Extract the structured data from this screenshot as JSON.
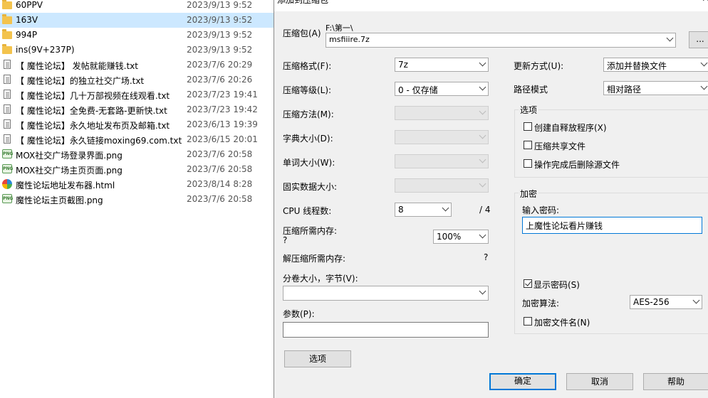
{
  "files": [
    {
      "name": "60PPV",
      "date": "2023/9/13 9:52",
      "type": "folder",
      "selected": false
    },
    {
      "name": "163V",
      "date": "2023/9/13 9:52",
      "type": "folder",
      "selected": true
    },
    {
      "name": "994P",
      "date": "2023/9/13 9:52",
      "type": "folder",
      "selected": false
    },
    {
      "name": "ins(9V+237P)",
      "date": "2023/9/13 9:52",
      "type": "folder",
      "selected": false
    },
    {
      "name": "【 魔性论坛】 发帖就能赚钱.txt",
      "date": "2023/7/6 20:29",
      "type": "txt",
      "selected": false
    },
    {
      "name": "【 魔性论坛】的独立社交广场.txt",
      "date": "2023/7/6 20:26",
      "type": "txt",
      "selected": false
    },
    {
      "name": "【 魔性论坛】几十万部视频在线观看.txt",
      "date": "2023/7/23 19:41",
      "type": "txt",
      "selected": false
    },
    {
      "name": "【 魔性论坛】全免费-无套路-更新快.txt",
      "date": "2023/7/23 19:42",
      "type": "txt",
      "selected": false
    },
    {
      "name": "【 魔性论坛】永久地址发布页及邮箱.txt",
      "date": "2023/6/13 19:39",
      "type": "txt",
      "selected": false
    },
    {
      "name": "【 魔性论坛】永久链接moxing69.com.txt",
      "date": "2023/6/15 20:01",
      "type": "txt",
      "selected": false
    },
    {
      "name": "MOX社交广场登录界面.png",
      "date": "2023/7/6 20:58",
      "type": "png",
      "selected": false
    },
    {
      "name": "MOX社交广场主页页面.png",
      "date": "2023/7/6 20:58",
      "type": "png",
      "selected": false
    },
    {
      "name": "魔性论坛地址发布器.html",
      "date": "2023/8/14 8:28",
      "type": "html",
      "selected": false
    },
    {
      "name": "魔性论坛主页截图.png",
      "date": "2023/7/6 20:58",
      "type": "png",
      "selected": false
    }
  ],
  "dialog": {
    "title": "添加到压缩包",
    "close": "✕",
    "archive_label": "压缩包(A)",
    "archive_path": "F:\\第一\\",
    "archive_name": "msfiiire.7z",
    "browse": "...",
    "format_label": "压缩格式(F):",
    "format_value": "7z",
    "level_label": "压缩等级(L):",
    "level_value": "0 - 仅存储",
    "method_label": "压缩方法(M):",
    "dict_label": "字典大小(D):",
    "word_label": "单词大小(W):",
    "solid_label": "固实数据大小:",
    "cpu_label": "CPU 线程数:",
    "cpu_value": "8",
    "cpu_total": "/ 4",
    "mem_comp_label": "压缩所需内存:",
    "mem_comp_value": "?",
    "mem_percent": "100%",
    "mem_decomp_label": "解压缩所需内存:",
    "mem_decomp_value": "?",
    "split_label": "分卷大小，字节(V):",
    "params_label": "参数(P):",
    "options_button": "选项",
    "update_label": "更新方式(U):",
    "update_value": "添加并替换文件",
    "pathmode_label": "路径模式",
    "pathmode_value": "相对路径",
    "options_group": "选项",
    "opt_sfx": "创建自释放程序(X)",
    "opt_shared": "压缩共享文件",
    "opt_delete": "操作完成后删除源文件",
    "encrypt_group": "加密",
    "password_label": "输入密码:",
    "password_value": "上魔性论坛看片赚钱",
    "show_password": "显示密码(S)",
    "enc_method_label": "加密算法:",
    "enc_method_value": "AES-256",
    "enc_names": "加密文件名(N)",
    "ok": "确定",
    "cancel": "取消",
    "help": "帮助"
  }
}
